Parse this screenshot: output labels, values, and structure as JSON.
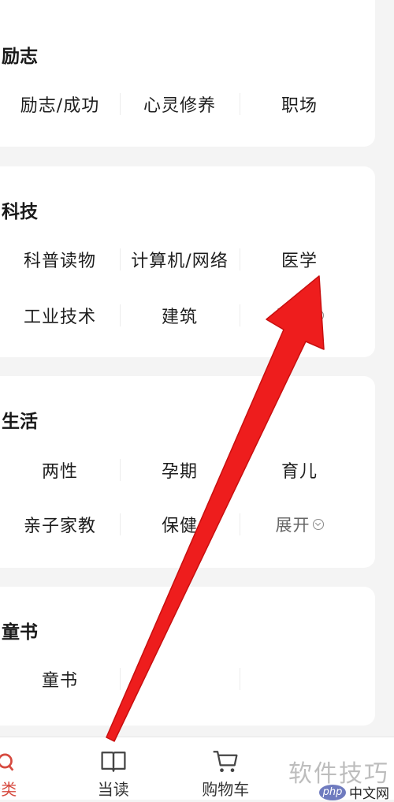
{
  "sections": [
    {
      "title": "励志",
      "rows": [
        [
          "励志/成功",
          "心灵修养",
          "职场"
        ]
      ]
    },
    {
      "title": "科技",
      "rows": [
        [
          "科普读物",
          "计算机/网络",
          "医学"
        ],
        [
          "工业技术",
          "建筑",
          "展开"
        ]
      ]
    },
    {
      "title": "生活",
      "rows": [
        [
          "两性",
          "孕期",
          "育儿"
        ],
        [
          "亲子家教",
          "保健",
          "展开"
        ]
      ]
    },
    {
      "title": "童书",
      "rows": [
        [
          "童书",
          "",
          ""
        ]
      ]
    }
  ],
  "tabs": [
    {
      "label": "分类",
      "icon": "search-list-icon",
      "active": true
    },
    {
      "label": "当读",
      "icon": "open-book-icon",
      "active": false
    },
    {
      "label": "购物车",
      "icon": "shopping-cart-icon",
      "active": false
    }
  ],
  "watermark": {
    "text": "软件技巧",
    "php": "php",
    "site": "中文网"
  },
  "colors": {
    "accent": "#d64a3f",
    "arrow": "#ee1d1d"
  }
}
